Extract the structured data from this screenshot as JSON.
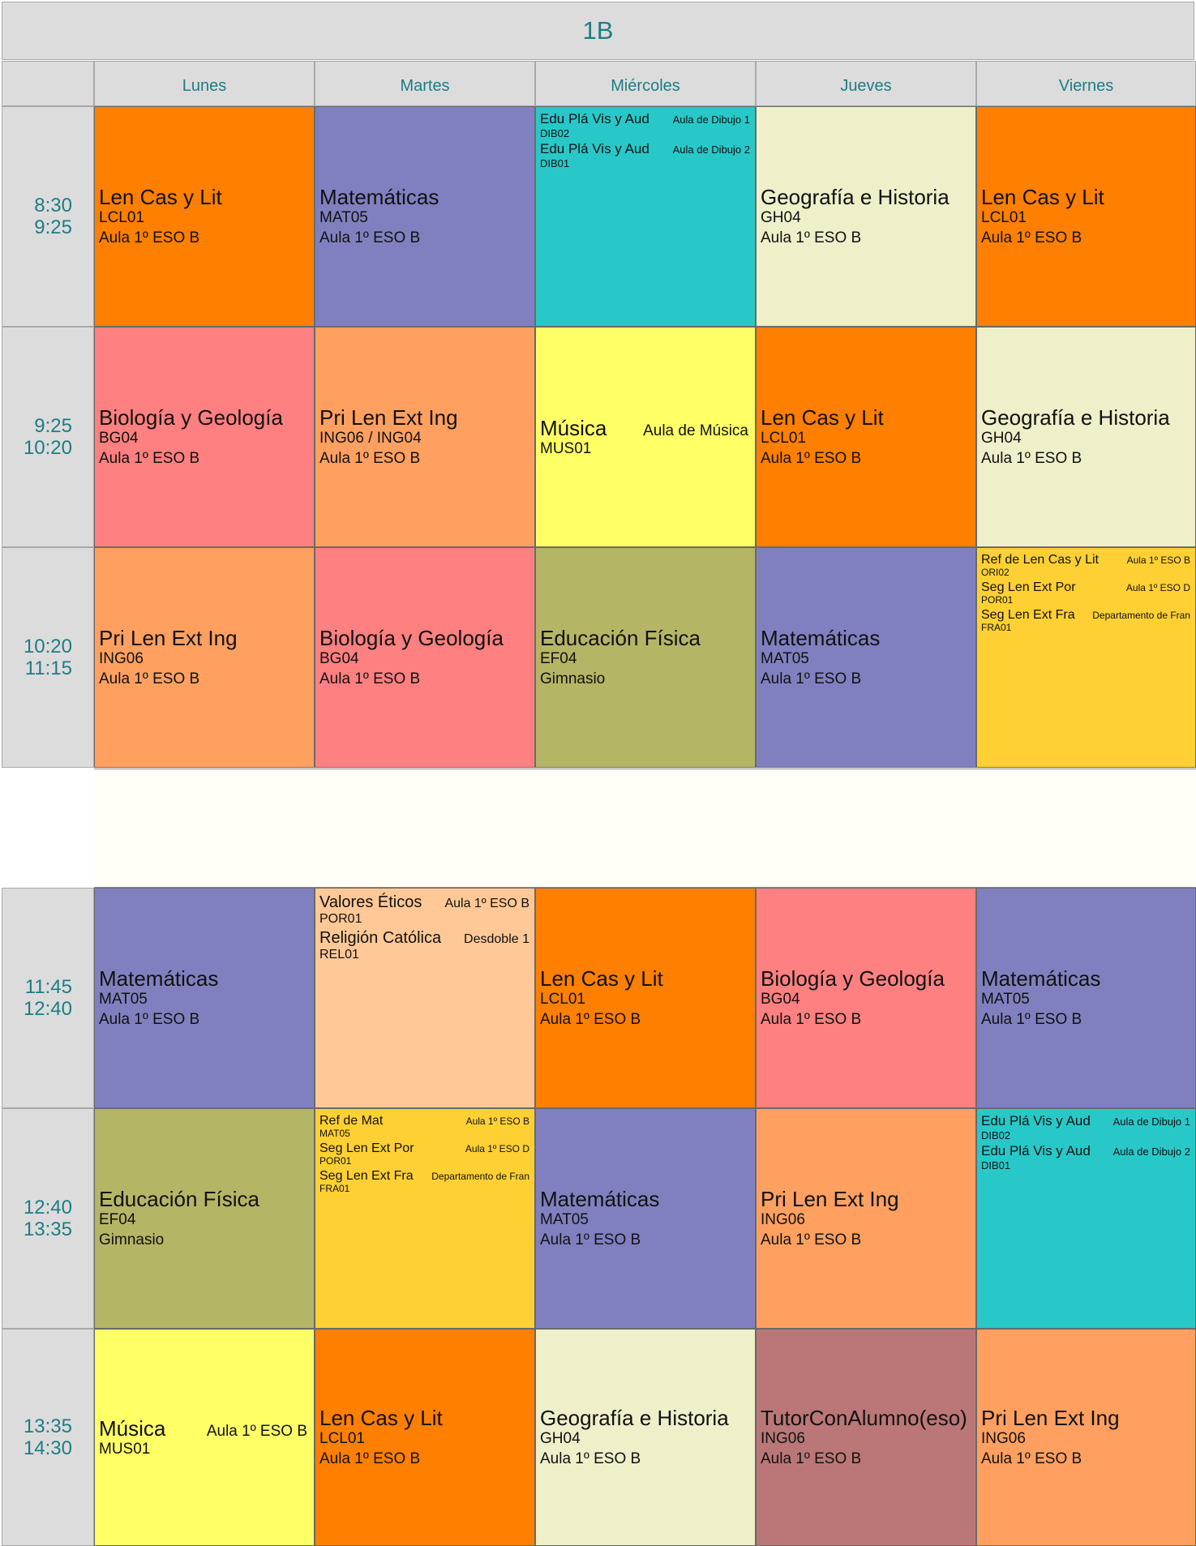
{
  "title": "1B",
  "days": [
    "Lunes",
    "Martes",
    "Miércoles",
    "Jueves",
    "Viernes"
  ],
  "slots": [
    {
      "start": "8:30",
      "end": "9:25"
    },
    {
      "start": "9:25",
      "end": "10:20"
    },
    {
      "start": "10:20",
      "end": "11:15"
    },
    {
      "start": "11:45",
      "end": "12:40"
    },
    {
      "start": "12:40",
      "end": "13:35"
    },
    {
      "start": "13:35",
      "end": "14:30"
    }
  ],
  "colors": {
    "orange": "#ff7f00",
    "purple": "#8080c0",
    "cyan": "#29c8c8",
    "cream": "#efefca",
    "pink": "#ff8080",
    "lightorange": "#ffa060",
    "yellow": "#ffff66",
    "olive": "#b5b566",
    "gold": "#ffd033",
    "peach": "#ffc896",
    "mauve": "#bb7777"
  },
  "grid": [
    [
      {
        "color": "orange",
        "subject": "Len Cas y Lit",
        "code": "LCL01",
        "room": "Aula 1º ESO  B"
      },
      {
        "color": "purple",
        "subject": "Matemáticas",
        "code": "MAT05",
        "room": "Aula 1º ESO  B"
      },
      {
        "color": "cyan",
        "entries": [
          {
            "subject": "Edu Plá Vis y Aud",
            "room": "Aula de Dibujo 1",
            "code": "DIB02"
          },
          {
            "subject": "Edu Plá Vis y Aud",
            "room": "Aula de Dibujo 2",
            "code": "DIB01"
          }
        ]
      },
      {
        "color": "cream",
        "subject": "Geografía e Historia",
        "code": "GH04",
        "room": "Aula 1º ESO  B"
      },
      {
        "color": "orange",
        "subject": "Len Cas y Lit",
        "code": "LCL01",
        "room": "Aula 1º ESO  B"
      }
    ],
    [
      {
        "color": "pink",
        "subject": "Biología y Geología",
        "code": "BG04",
        "room": "Aula 1º ESO  B"
      },
      {
        "color": "lightorange",
        "subject": "Pri Len Ext Ing",
        "code": "ING06 / ING04",
        "room": "Aula 1º ESO  B"
      },
      {
        "color": "yellow",
        "inline": true,
        "subject": "Música",
        "room": "Aula de Música",
        "code": "MUS01"
      },
      {
        "color": "orange",
        "subject": "Len Cas y Lit",
        "code": "LCL01",
        "room": "Aula 1º ESO  B"
      },
      {
        "color": "cream",
        "subject": "Geografía e Historia",
        "code": "GH04",
        "room": "Aula 1º ESO  B"
      }
    ],
    [
      {
        "color": "lightorange",
        "subject": "Pri Len Ext Ing",
        "code": "ING06",
        "room": "Aula 1º ESO  B"
      },
      {
        "color": "pink",
        "subject": "Biología y Geología",
        "code": "BG04",
        "room": "Aula 1º ESO  B"
      },
      {
        "color": "olive",
        "subject": "Educación Física",
        "code": "EF04",
        "room": "Gimnasio"
      },
      {
        "color": "purple",
        "subject": "Matemáticas",
        "code": "MAT05",
        "room": "Aula 1º ESO  B"
      },
      {
        "color": "gold",
        "size": "small",
        "entries": [
          {
            "subject": "Ref de Len Cas y Lit",
            "room": "Aula 1º ESO  B",
            "code": "ORI02"
          },
          {
            "subject": "Seg Len Ext Por",
            "room": "Aula 1º ESO D",
            "code": "POR01"
          },
          {
            "subject": "Seg Len Ext Fra",
            "room": "Departamento de Fran",
            "code": "FRA01"
          }
        ]
      }
    ],
    [
      {
        "color": "purple",
        "subject": "Matemáticas",
        "code": "MAT05",
        "room": "Aula 1º ESO  B"
      },
      {
        "color": "peach",
        "size": "big",
        "entries": [
          {
            "subject": "Valores Éticos",
            "room": "Aula 1º ESO  B",
            "code": "POR01"
          },
          {
            "subject": "Religión Católica",
            "room": "Desdoble 1",
            "code": "REL01"
          }
        ]
      },
      {
        "color": "orange",
        "subject": "Len Cas y Lit",
        "code": "LCL01",
        "room": "Aula 1º ESO  B"
      },
      {
        "color": "pink",
        "subject": "Biología y Geología",
        "code": "BG04",
        "room": "Aula 1º ESO  B"
      },
      {
        "color": "purple",
        "subject": "Matemáticas",
        "code": "MAT05",
        "room": "Aula 1º ESO  B"
      }
    ],
    [
      {
        "color": "olive",
        "subject": "Educación Física",
        "code": "EF04",
        "room": "Gimnasio"
      },
      {
        "color": "gold",
        "size": "small",
        "entries": [
          {
            "subject": "Ref de Mat",
            "room": "Aula 1º ESO  B",
            "code": "MAT05"
          },
          {
            "subject": "Seg Len Ext Por",
            "room": "Aula 1º ESO D",
            "code": "POR01"
          },
          {
            "subject": "Seg Len Ext Fra",
            "room": "Departamento de Fran",
            "code": "FRA01"
          }
        ]
      },
      {
        "color": "purple",
        "subject": "Matemáticas",
        "code": "MAT05",
        "room": "Aula 1º ESO  B"
      },
      {
        "color": "lightorange",
        "subject": "Pri Len Ext Ing",
        "code": "ING06",
        "room": "Aula 1º ESO  B"
      },
      {
        "color": "cyan",
        "entries": [
          {
            "subject": "Edu Plá Vis y Aud",
            "room": "Aula de Dibujo 1",
            "code": "DIB02"
          },
          {
            "subject": "Edu Plá Vis y Aud",
            "room": "Aula de Dibujo 2",
            "code": "DIB01"
          }
        ]
      }
    ],
    [
      {
        "color": "yellow",
        "inline": true,
        "subject": "Música",
        "room": "Aula 1º ESO  B",
        "code": "MUS01"
      },
      {
        "color": "orange",
        "subject": "Len Cas y Lit",
        "code": "LCL01",
        "room": "Aula 1º ESO  B"
      },
      {
        "color": "cream",
        "subject": "Geografía e Historia",
        "code": "GH04",
        "room": "Aula 1º ESO  B"
      },
      {
        "color": "mauve",
        "subject": "TutorConAlumno(eso)",
        "code": "ING06",
        "room": "Aula 1º ESO  B"
      },
      {
        "color": "lightorange",
        "subject": "Pri Len Ext Ing",
        "code": "ING06",
        "room": "Aula 1º ESO  B"
      }
    ]
  ]
}
